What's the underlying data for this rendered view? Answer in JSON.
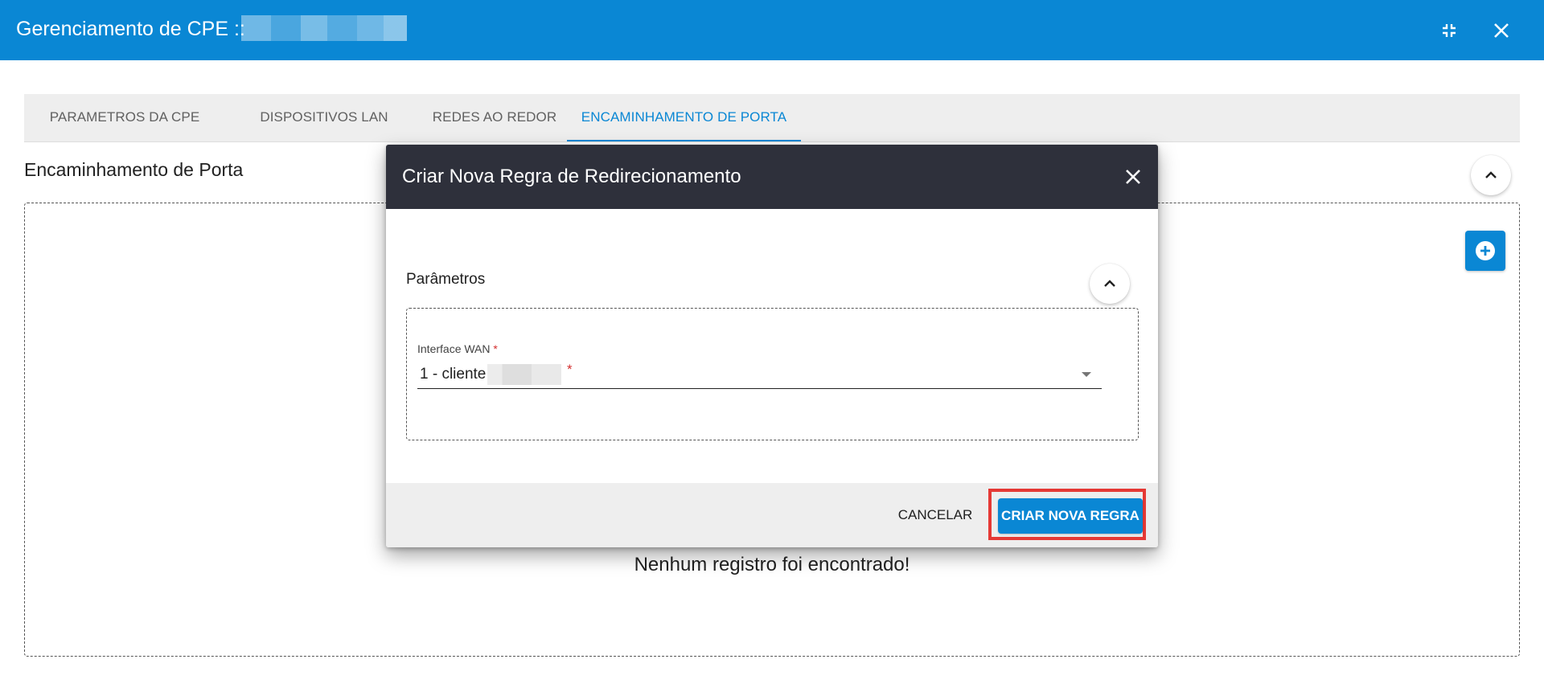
{
  "app": {
    "title": "Gerenciamento de CPE ::",
    "header_color": "#0a87d4",
    "icons": {
      "minimize": "minimize-icon",
      "close": "close-icon"
    }
  },
  "tabs": [
    {
      "label": "PARAMETROS DA CPE",
      "active": false
    },
    {
      "label": "DISPOSITIVOS LAN",
      "active": false
    },
    {
      "label": "REDES AO REDOR",
      "active": false
    },
    {
      "label": "ENCAMINHAMENTO DE PORTA",
      "active": true
    }
  ],
  "main": {
    "section_title": "Encaminhamento de Porta",
    "empty_message": "Nenhum registro foi encontrado!",
    "icons": {
      "collapse": "chevron-up-icon",
      "add": "add-circle-icon"
    }
  },
  "dialog": {
    "title": "Criar Nova Regra de Redirecionamento",
    "header_color": "#2e303b",
    "params_label": "Parâmetros",
    "field": {
      "label": "Interface WAN",
      "required_mark": "*",
      "value": "1 - cliente"
    },
    "cancel_label": "CANCELAR",
    "submit_label": "CRIAR NOVA REGRA",
    "highlight_color": "#e53935"
  }
}
